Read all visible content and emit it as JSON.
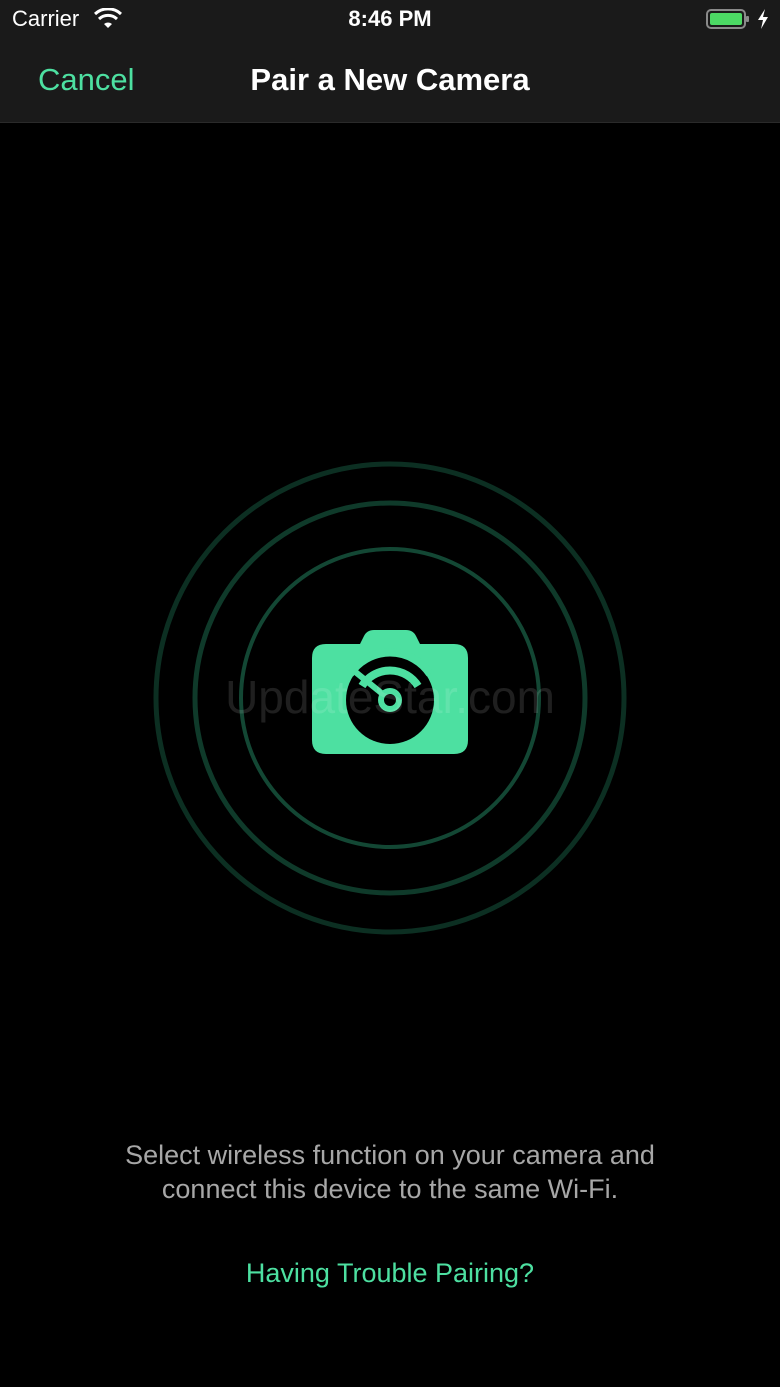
{
  "status_bar": {
    "carrier": "Carrier",
    "time": "8:46 PM",
    "icons": [
      "wifi-icon",
      "battery-icon",
      "charging-bolt-icon"
    ]
  },
  "nav": {
    "cancel_label": "Cancel",
    "title": "Pair a New Camera"
  },
  "main": {
    "icon": "wireless-camera-icon",
    "watermark": "UpdateStar.com",
    "instructions_line1": "Select wireless function on your camera and",
    "instructions_line2": "connect this device to the same Wi-Fi.",
    "trouble_link": "Having Trouble Pairing?"
  },
  "colors": {
    "accent": "#4de0a1",
    "background": "#000000",
    "nav_background": "#1a1a1a",
    "ring": "#0f3a2a",
    "instruction_text": "#a7a7a7",
    "battery": "#4cd964"
  }
}
